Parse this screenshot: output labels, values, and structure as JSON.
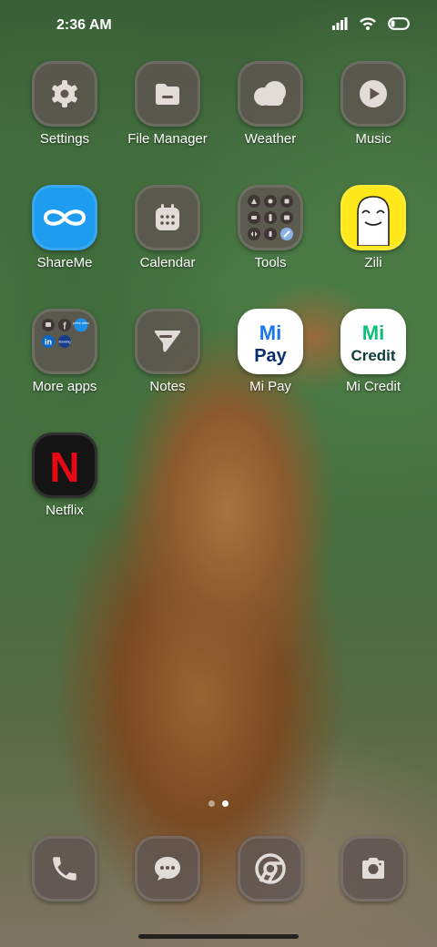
{
  "status_bar": {
    "time": "2:36 AM"
  },
  "apps": {
    "settings": "Settings",
    "file_manager": "File Manager",
    "weather": "Weather",
    "music": "Music",
    "shareme": "ShareMe",
    "calendar": "Calendar",
    "tools": "Tools",
    "zili": "Zili",
    "more_apps": "More apps",
    "notes": "Notes",
    "mi_pay": "Mi Pay",
    "mi_credit": "Mi Credit",
    "netflix": "Netflix"
  },
  "icon_text": {
    "mi_pay_top": "Mi",
    "mi_pay_bottom": "Pay",
    "mi_credit_top": "Mi",
    "mi_credit_bottom": "Credit",
    "netflix_letter": "N",
    "folder_prime": "prime video",
    "folder_booking": "Booking",
    "folder_linkedin": "in",
    "folder_facebook": "f"
  },
  "page_indicator": {
    "pages": 2,
    "current": 2
  },
  "colors": {
    "icon_background": "#5f5450",
    "shareme_blue": "#1e9df0",
    "zili_yellow": "#ffe81a",
    "mi_green": "#0bbf79",
    "mi_blue": "#1976f0",
    "netflix_red": "#e50914"
  }
}
